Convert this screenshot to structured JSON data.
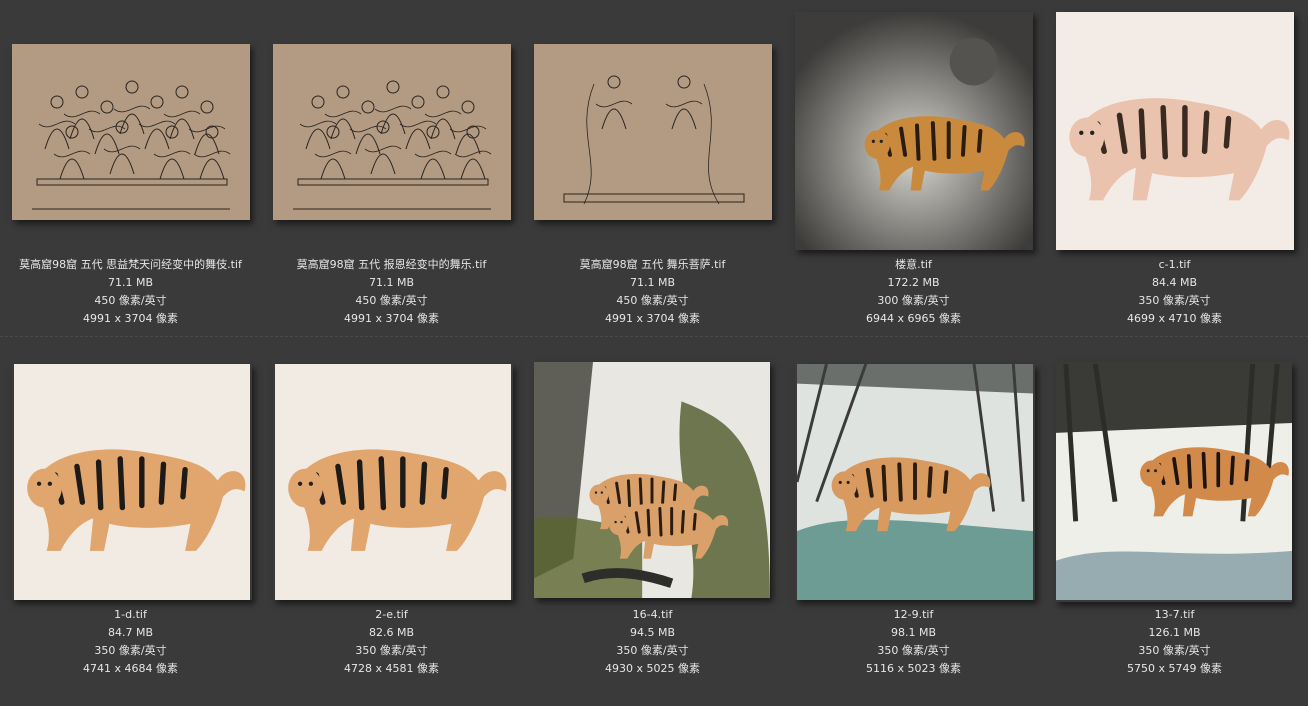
{
  "files": [
    {
      "name": "莫高窟98窟 五代 思益梵天问经变中的舞伎.tif",
      "size": "71.1 MB",
      "resolution": "450 像素/英寸",
      "dimensions": "4991 x 3704 像素",
      "kind": "sketch"
    },
    {
      "name": "莫高窟98窟 五代 报恩经变中的舞乐.tif",
      "size": "71.1 MB",
      "resolution": "450 像素/英寸",
      "dimensions": "4991 x 3704 像素",
      "kind": "sketch"
    },
    {
      "name": "莫高窟98窟 五代 舞乐菩萨.tif",
      "size": "71.1 MB",
      "resolution": "450 像素/英寸",
      "dimensions": "4991 x 3704 像素",
      "kind": "sketch"
    },
    {
      "name": "楼意.tif",
      "size": "172.2 MB",
      "resolution": "300 像素/英寸",
      "dimensions": "6944 x 6965 像素",
      "kind": "night-tiger"
    },
    {
      "name": "c-1.tif",
      "size": "84.4 MB",
      "resolution": "350 像素/英寸",
      "dimensions": "4699 x 4710 像素",
      "kind": "pale-tiger"
    },
    {
      "name": "1-d.tif",
      "size": "84.7 MB",
      "resolution": "350 像素/英寸",
      "dimensions": "4741 x 4684 像素",
      "kind": "tiger"
    },
    {
      "name": "2-e.tif",
      "size": "82.6 MB",
      "resolution": "350 像素/英寸",
      "dimensions": "4728 x 4581 像素",
      "kind": "tiger"
    },
    {
      "name": "16-4.tif",
      "size": "94.5 MB",
      "resolution": "350 像素/英寸",
      "dimensions": "4930 x 5025 像素",
      "kind": "landscape-tiger"
    },
    {
      "name": "12-9.tif",
      "size": "98.1 MB",
      "resolution": "350 像素/英寸",
      "dimensions": "5116 x 5023 像素",
      "kind": "landscape-tiger-2"
    },
    {
      "name": "13-7.tif",
      "size": "126.1 MB",
      "resolution": "350 像素/英寸",
      "dimensions": "5750 x 5749 像素",
      "kind": "forest-tiger"
    }
  ]
}
